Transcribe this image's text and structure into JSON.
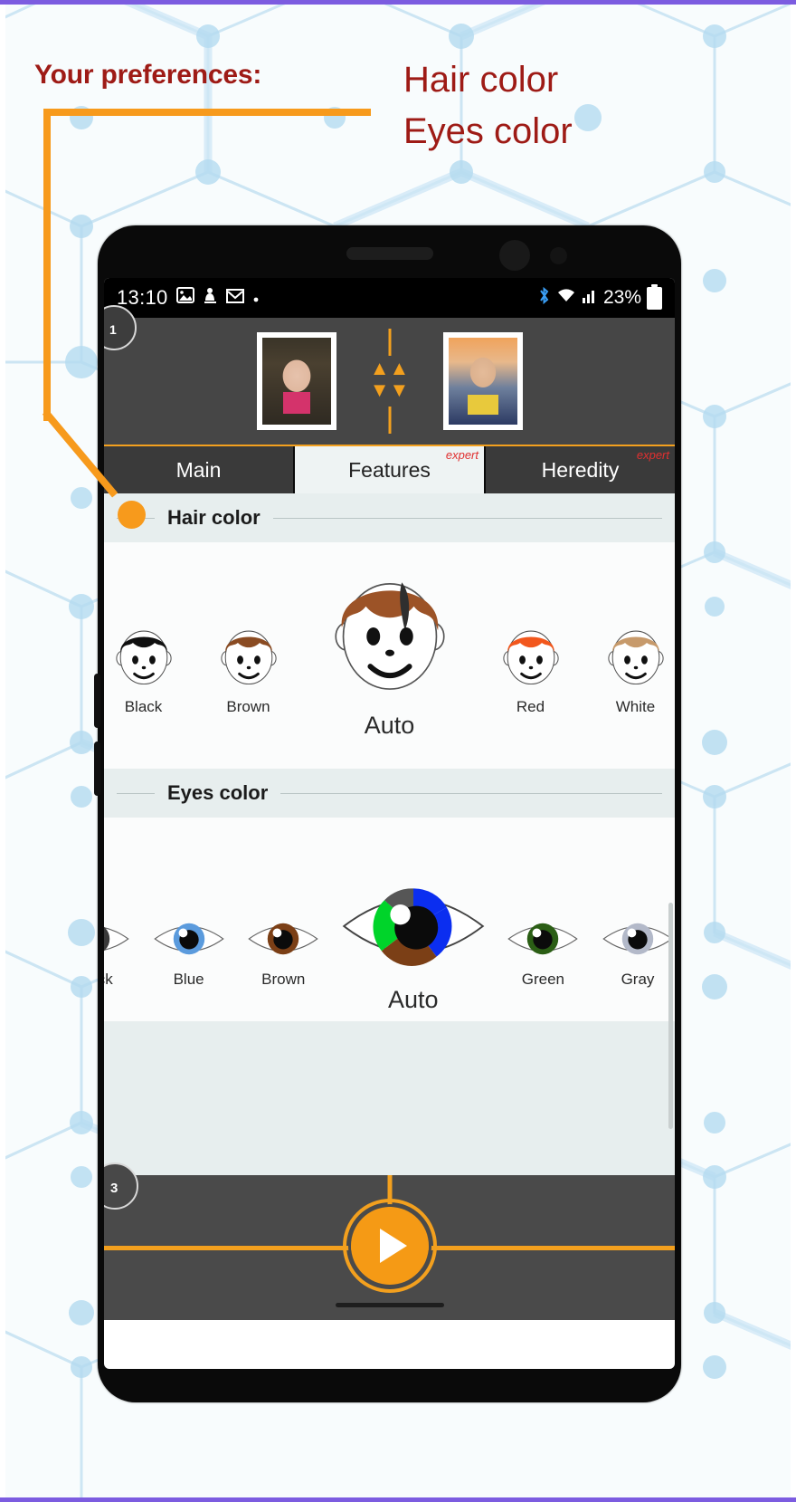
{
  "annotation": {
    "title": "Your preferences:",
    "lines": [
      "Hair color",
      "Eyes color"
    ],
    "accent_color": "#f79a1c",
    "title_color": "#9e1b16",
    "step_markers": [
      "1",
      "3"
    ]
  },
  "statusbar": {
    "time": "13:10",
    "left_icons": [
      "gallery-icon",
      "figure-icon",
      "gmail-icon",
      "dot-icon"
    ],
    "right_icons": [
      "bluetooth-icon",
      "wifi-icon",
      "signal-icon"
    ],
    "battery_percent": "23%"
  },
  "photo_header": {
    "left_photo_alt": "mother-photo",
    "right_photo_alt": "father-photo",
    "swap_icon": "double-chevron-icon"
  },
  "tabs": [
    {
      "label": "Main",
      "badge": "",
      "active": false
    },
    {
      "label": "Features",
      "badge": "expert",
      "active": true
    },
    {
      "label": "Heredity",
      "badge": "expert",
      "active": false
    }
  ],
  "sections": [
    {
      "title": "Hair color",
      "selected": "Auto",
      "options": [
        {
          "label": "Black",
          "color": "#101010",
          "selected": false
        },
        {
          "label": "Brown",
          "color": "#8a4b22",
          "selected": false
        },
        {
          "label": "Auto",
          "color": "#9c5327",
          "selected": true
        },
        {
          "label": "Red",
          "color": "#f2571d",
          "selected": false
        },
        {
          "label": "White",
          "color": "#c79a6b",
          "selected": false
        }
      ]
    },
    {
      "title": "Eyes color",
      "selected": "Auto",
      "options": [
        {
          "label": "Black",
          "color": "#3a3a3a",
          "selected": false
        },
        {
          "label": "Blue",
          "color": "#5b9bdd",
          "selected": false
        },
        {
          "label": "Brown",
          "color": "#7b3f16",
          "selected": false
        },
        {
          "label": "Auto",
          "color": "#00d42a",
          "selected": true
        },
        {
          "label": "Green",
          "color": "#2b5e15",
          "selected": false
        },
        {
          "label": "Gray",
          "color": "#b3b9c9",
          "selected": false
        }
      ]
    }
  ],
  "bottom": {
    "play_label": "play-button"
  }
}
